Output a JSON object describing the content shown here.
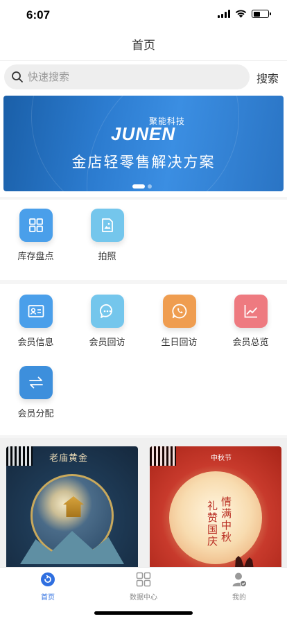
{
  "status": {
    "time": "6:07"
  },
  "nav": {
    "title": "首页"
  },
  "search": {
    "placeholder": "快速搜索",
    "button": "搜索"
  },
  "banner": {
    "sub": "聚能科技",
    "logo": "JUNEN",
    "title": "金店轻零售解决方案"
  },
  "tools": [
    {
      "label": "库存盘点",
      "icon": "grid-icon",
      "color": "#4a9fea"
    },
    {
      "label": "拍照",
      "icon": "image-icon",
      "color": "#74c6ec"
    }
  ],
  "members": [
    {
      "label": "会员信息",
      "icon": "id-card-icon",
      "color": "#4a9fea"
    },
    {
      "label": "会员回访",
      "icon": "chat-icon",
      "color": "#74c6ec"
    },
    {
      "label": "生日回访",
      "icon": "phone-icon",
      "color": "#ef9d50"
    },
    {
      "label": "会员总览",
      "icon": "chart-icon",
      "color": "#ee7a80"
    },
    {
      "label": "会员分配",
      "icon": "swap-icon",
      "color": "#3d8fdc"
    }
  ],
  "posters": {
    "left": {
      "brand": "老庙黄金"
    },
    "right": {
      "badge": "中秋节",
      "col1": "礼赞国庆",
      "col2": "情满中秋"
    }
  },
  "tabs": [
    {
      "label": "首页",
      "icon": "home-icon",
      "active": true
    },
    {
      "label": "数据中心",
      "icon": "data-center-icon",
      "active": false
    },
    {
      "label": "我的",
      "icon": "profile-icon",
      "active": false
    }
  ],
  "colors": {
    "accent": "#2f6fe0"
  }
}
